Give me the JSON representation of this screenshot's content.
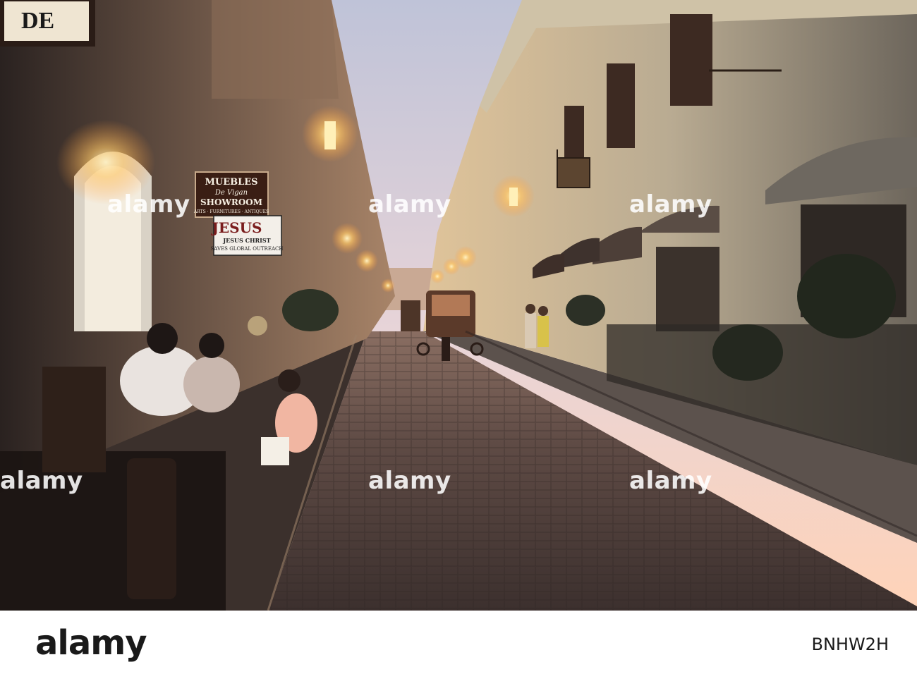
{
  "photo": {
    "sign_top_left": "DE",
    "shop_sign": {
      "line1": "MUEBLES",
      "line2": "De Vigan",
      "line3": "SHOWROOM",
      "line4": "ARTS · FURNITURES · ANTIQUES"
    },
    "church_sign": {
      "line1": "JESUS",
      "line2": "JESUS CHRIST",
      "line3": "SAVES GLOBAL OUTREACH"
    }
  },
  "watermark": {
    "text": "alamy"
  },
  "footer": {
    "logo": "alamy",
    "image_id": "BNHW2H"
  },
  "colors": {
    "sky_top": "#c9c7d6",
    "sky_bottom": "#ffd9c2",
    "lamp_glow": "#ffcf73",
    "street": "#5a4a44",
    "footer_bg": "#ffffff"
  }
}
